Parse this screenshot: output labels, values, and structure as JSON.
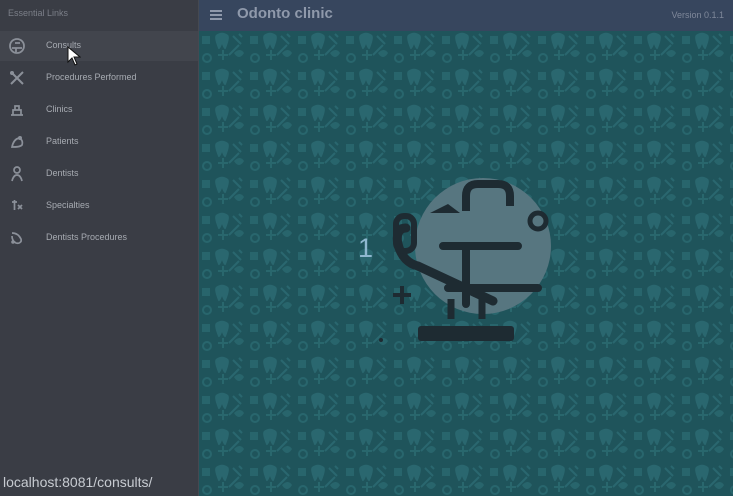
{
  "app": {
    "title": "Odonto clinic",
    "version": "Version 0.1.1"
  },
  "drawer": {
    "title": "Essential Links",
    "items": [
      {
        "label": "Consults",
        "icon": "dental-chair-icon",
        "active": true
      },
      {
        "label": "Procedures Performed",
        "icon": "dental-tools-icon",
        "active": false
      },
      {
        "label": "Clinics",
        "icon": "clinic-icon",
        "active": false
      },
      {
        "label": "Patients",
        "icon": "patient-icon",
        "active": false
      },
      {
        "label": "Dentists",
        "icon": "dentist-icon",
        "active": false
      },
      {
        "label": "Specialties",
        "icon": "specialty-icon",
        "active": false
      },
      {
        "label": "Dentists Procedures",
        "icon": "procedures-icon",
        "active": false
      }
    ]
  },
  "main": {
    "background_color": "#1f545b",
    "badge_number": "1"
  },
  "status": {
    "url": "localhost:8081/consults/"
  }
}
